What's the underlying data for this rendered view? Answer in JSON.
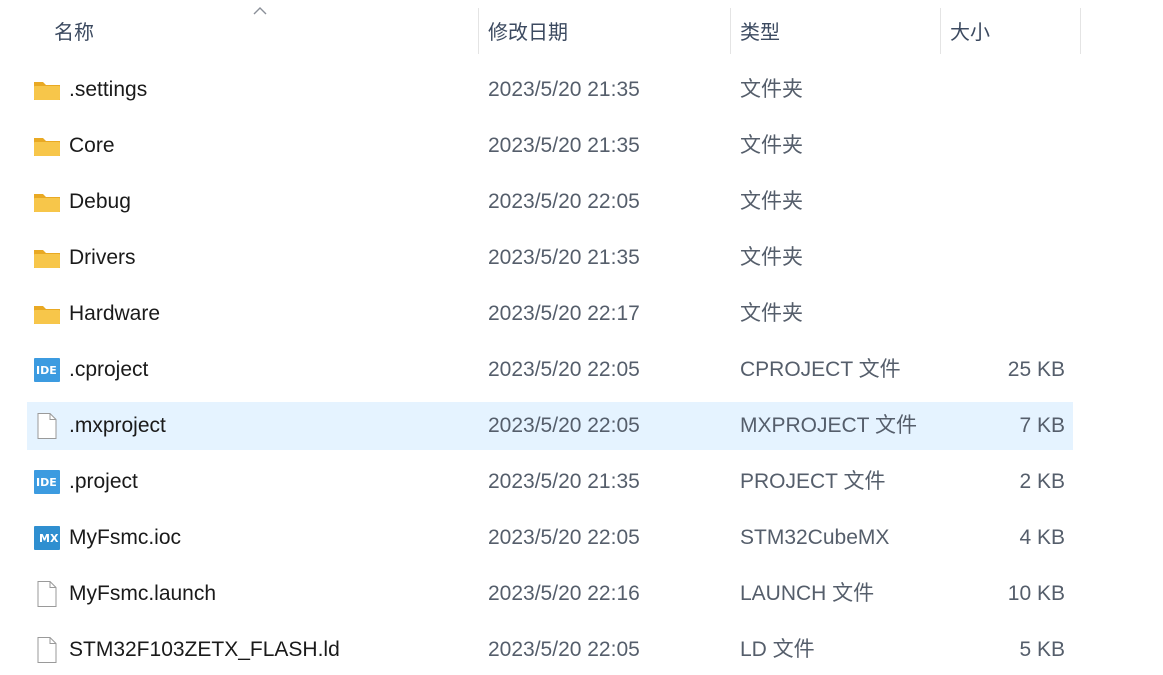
{
  "columns": {
    "name": "名称",
    "date": "修改日期",
    "type": "类型",
    "size": "大小"
  },
  "files": [
    {
      "name": ".settings",
      "date": "2023/5/20 21:35",
      "type": "文件夹",
      "size": "",
      "icon": "folder-icon"
    },
    {
      "name": "Core",
      "date": "2023/5/20 21:35",
      "type": "文件夹",
      "size": "",
      "icon": "folder-icon"
    },
    {
      "name": "Debug",
      "date": "2023/5/20 22:05",
      "type": "文件夹",
      "size": "",
      "icon": "folder-icon"
    },
    {
      "name": "Drivers",
      "date": "2023/5/20 21:35",
      "type": "文件夹",
      "size": "",
      "icon": "folder-icon"
    },
    {
      "name": "Hardware",
      "date": "2023/5/20 22:17",
      "type": "文件夹",
      "size": "",
      "icon": "folder-icon"
    },
    {
      "name": ".cproject",
      "date": "2023/5/20 22:05",
      "type": "CPROJECT 文件",
      "size": "25 KB",
      "icon": "ide-file-icon",
      "badge": "IDE"
    },
    {
      "name": ".mxproject",
      "date": "2023/5/20 22:05",
      "type": "MXPROJECT 文件",
      "size": "7 KB",
      "icon": "blank-file-icon",
      "selected": true
    },
    {
      "name": ".project",
      "date": "2023/5/20 21:35",
      "type": "PROJECT 文件",
      "size": "2 KB",
      "icon": "ide-file-icon",
      "badge": "IDE"
    },
    {
      "name": "MyFsmc.ioc",
      "date": "2023/5/20 22:05",
      "type": "STM32CubeMX",
      "size": "4 KB",
      "icon": "cubemx-file-icon",
      "badge": "MX"
    },
    {
      "name": "MyFsmc.launch",
      "date": "2023/5/20 22:16",
      "type": "LAUNCH 文件",
      "size": "10 KB",
      "icon": "blank-file-icon"
    },
    {
      "name": "STM32F103ZETX_FLASH.ld",
      "date": "2023/5/20 22:05",
      "type": "LD 文件",
      "size": "5 KB",
      "icon": "blank-file-icon"
    }
  ],
  "colors": {
    "folder": "#f7c64a",
    "folder_back": "#e9a923",
    "ide_badge": "#3c9be0",
    "mx_badge": "#2f8fd0",
    "selection": "#e5f3ff",
    "header_text": "#3c4a60"
  },
  "sort": {
    "column": "name",
    "direction": "ascending"
  }
}
